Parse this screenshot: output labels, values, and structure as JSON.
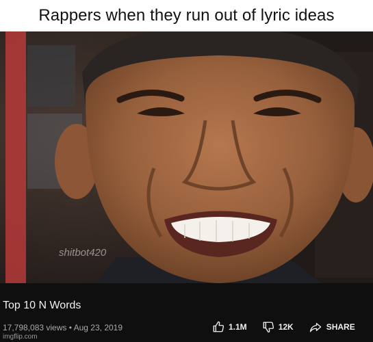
{
  "meme": {
    "caption": "Rappers when they run out of lyric ideas"
  },
  "thumbnail": {
    "watermark": "shitbot420",
    "description_icon": "smiling-face-photo"
  },
  "video": {
    "title": "Top 10 N Words",
    "views": "17,798,083 views",
    "separator": "•",
    "date": "Aug 23, 2019"
  },
  "actions": {
    "like_count": "1.1M",
    "dislike_count": "12K",
    "share_label": "SHARE"
  },
  "footer": {
    "credit": "imgflip.com"
  },
  "colors": {
    "caption_bg": "#ffffff",
    "info_bg": "#0f0f0f",
    "text_primary": "#f1f1f1",
    "text_secondary": "#aaaaaa"
  }
}
